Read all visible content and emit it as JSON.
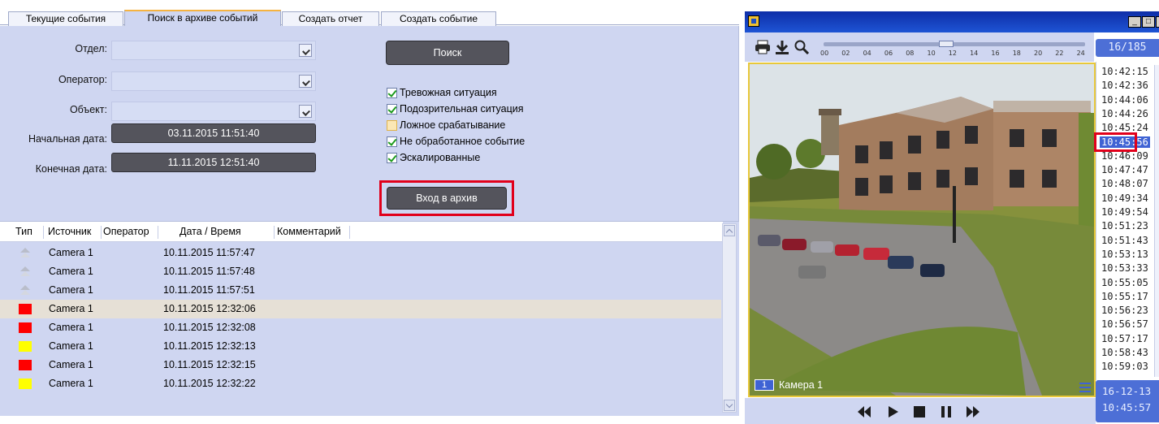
{
  "tabs": [
    {
      "label": "Текущие события",
      "active": false
    },
    {
      "label": "Поиск в архиве событий",
      "active": true
    },
    {
      "label": "Создать отчет",
      "active": false
    },
    {
      "label": "Создать событие",
      "active": false
    }
  ],
  "form": {
    "department_label": "Отдел:",
    "operator_label": "Оператор:",
    "object_label": "Объект:",
    "start_date_label": "Начальная дата:",
    "end_date_label": "Конечная дата:",
    "start_date": "03.11.2015 11:51:40",
    "end_date": "11.11.2015 12:51:40",
    "search_button": "Поиск",
    "archive_button": "Вход в архив",
    "checkboxes": [
      {
        "label": "Тревожная ситуация",
        "checked": true
      },
      {
        "label": "Подозрительная ситуация",
        "checked": true
      },
      {
        "label": "Ложное срабатывание",
        "checked": false
      },
      {
        "label": "Не обработанное событие",
        "checked": true
      },
      {
        "label": "Эскалированные",
        "checked": true
      }
    ]
  },
  "table": {
    "columns": [
      "Тип",
      "Источник",
      "Оператор",
      "Дата / Время",
      "Комментарий"
    ],
    "rows": [
      {
        "type": "gray",
        "source": "Camera 1",
        "datetime": "10.11.2015 11:57:47"
      },
      {
        "type": "gray",
        "source": "Camera 1",
        "datetime": "10.11.2015 11:57:48"
      },
      {
        "type": "gray",
        "source": "Camera 1",
        "datetime": "10.11.2015 11:57:51"
      },
      {
        "type": "red",
        "source": "Camera 1",
        "datetime": "10.11.2015 12:32:06",
        "selected": true
      },
      {
        "type": "red",
        "source": "Camera 1",
        "datetime": "10.11.2015 12:32:08"
      },
      {
        "type": "yellow",
        "source": "Camera 1",
        "datetime": "10.11.2015 12:32:13"
      },
      {
        "type": "red",
        "source": "Camera 1",
        "datetime": "10.11.2015 12:32:15"
      },
      {
        "type": "yellow",
        "source": "Camera 1",
        "datetime": "10.11.2015 12:32:22"
      }
    ]
  },
  "video": {
    "counter": "16/185",
    "camera_number": "1",
    "camera_name": "Камера 1",
    "timeline_ticks": [
      "00",
      "02",
      "04",
      "06",
      "08",
      "10",
      "12",
      "14",
      "16",
      "18",
      "20",
      "22",
      "24"
    ],
    "times": [
      "10:42:15",
      "10:42:36",
      "10:44:06",
      "10:44:26",
      "10:45:24",
      "10:45:56",
      "10:46:09",
      "10:47:47",
      "10:48:07",
      "10:49:34",
      "10:49:54",
      "10:51:23",
      "10:51:43",
      "10:53:13",
      "10:53:33",
      "10:55:05",
      "10:55:17",
      "10:56:23",
      "10:56:57",
      "10:57:17",
      "10:58:43",
      "10:59:03"
    ],
    "selected_time_index": 5,
    "date": "16-12-13",
    "time": "10:45:57"
  },
  "colors": {
    "panel": "#cfd6f1",
    "dark_button": "#54545c",
    "highlight": "#e1001b",
    "accent": "#3f63d4"
  }
}
